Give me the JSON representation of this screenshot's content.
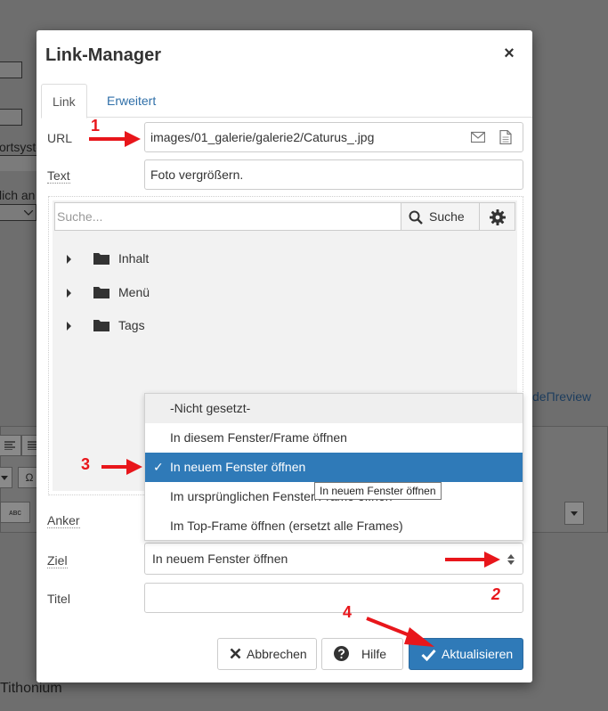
{
  "background": {
    "text_1": "ortsyste",
    "text_2": "lich an",
    "link_text": "deПreview",
    "tool_omega": "Ω",
    "tool_abc": "ᴀʙᴄ",
    "bottom_text": "Tithonium"
  },
  "modal": {
    "title": "Link-Manager",
    "close_label": "×",
    "tabs": [
      {
        "label": "Link",
        "active": true
      },
      {
        "label": "Erweitert",
        "active": false
      }
    ],
    "fields": {
      "url_label": "URL",
      "url_value": "images/01_galerie/galerie2/Caturus_.jpg",
      "text_label": "Text",
      "text_value": "Foto vergrößern.",
      "anker_label": "Anker",
      "ziel_label": "Ziel",
      "ziel_value": "In neuem Fenster öffnen",
      "titel_label": "Titel"
    },
    "browser": {
      "search_placeholder": "Suche...",
      "search_button": "Suche",
      "tree": [
        {
          "label": "Inhalt"
        },
        {
          "label": "Menü"
        },
        {
          "label": "Tags"
        }
      ]
    },
    "dropdown": {
      "options": [
        {
          "label": "-Nicht gesetzt-",
          "selected": false
        },
        {
          "label": "In diesem Fenster/Frame öffnen",
          "selected": false
        },
        {
          "label": "In neuem Fenster öffnen",
          "selected": true
        },
        {
          "label": "Im ursprünglichen Fenster/Frame öffnen",
          "selected": false
        },
        {
          "label": "Im Top-Frame öffnen (ersetzt alle Frames)",
          "selected": false
        }
      ],
      "check_glyph": "✓",
      "tooltip": "In neuem Fenster öffnen"
    },
    "buttons": {
      "cancel": "Abbrechen",
      "help": "Hilfe",
      "update": "Aktualisieren"
    }
  },
  "annotations": {
    "n1": "1",
    "n2": "2",
    "n3": "3",
    "n4": "4",
    "color": "#e8161b"
  },
  "colors": {
    "primary": "#2f7ab8",
    "link": "#2f6fa8",
    "overlay": "#6e6e6e"
  }
}
